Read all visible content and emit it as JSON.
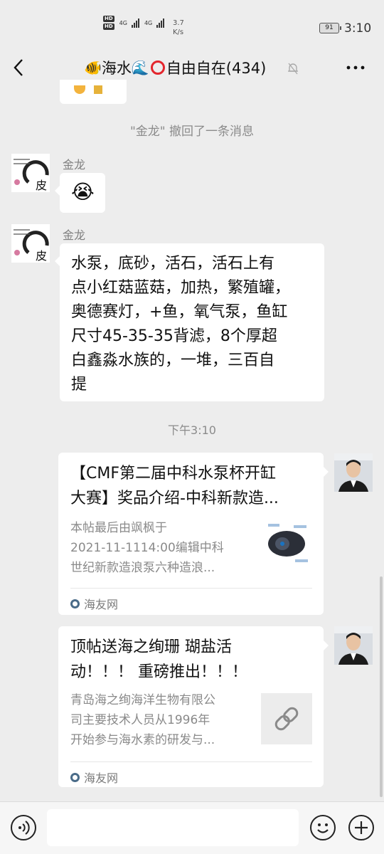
{
  "status_bar": {
    "net_a": "4G",
    "net_b": "4G",
    "speed_value": "3.7",
    "speed_unit": "K/s",
    "battery": "91",
    "time": "3:10"
  },
  "header": {
    "title_prefix_emoji": "🐠",
    "title_word": "海水",
    "title_wave_emoji": "🌊",
    "title_main": "自由自在(434)"
  },
  "chat": {
    "recall_notice": "\"金龙\" 撤回了一条消息",
    "msg1": {
      "sender": "金龙",
      "content": "😭"
    },
    "msg2": {
      "sender": "金龙",
      "lines": [
        "水泵，底砂，活石，活石上有",
        "点小红菇蓝菇，加热，繁殖罐，",
        "奥德赛灯，+鱼，氧气泵，鱼缸",
        "尺寸45-35-35背滤，8个厚超",
        "白鑫淼水族的，一堆，三百自",
        "提"
      ]
    },
    "time_divider": "下午3:10",
    "card1": {
      "title_lines": [
        "【CMF第二届中科水泵杯开缸",
        "大赛】奖品介绍-中科新款造..."
      ],
      "desc_lines": [
        "本帖最后由飒枫于",
        "2021-11-1114:00编辑中科",
        "世纪新款造浪泵六种造浪..."
      ],
      "source": "海友网"
    },
    "card2": {
      "title_lines": [
        "顶帖送海之绚珊 瑚盐活",
        "动！！！ 重磅推出！！！"
      ],
      "desc_lines": [
        "青岛海之绚海洋生物有限公",
        "司主要技术人员从1996年",
        "开始参与海水素的研发与..."
      ],
      "source": "海友网"
    }
  },
  "input": {
    "value": ""
  }
}
